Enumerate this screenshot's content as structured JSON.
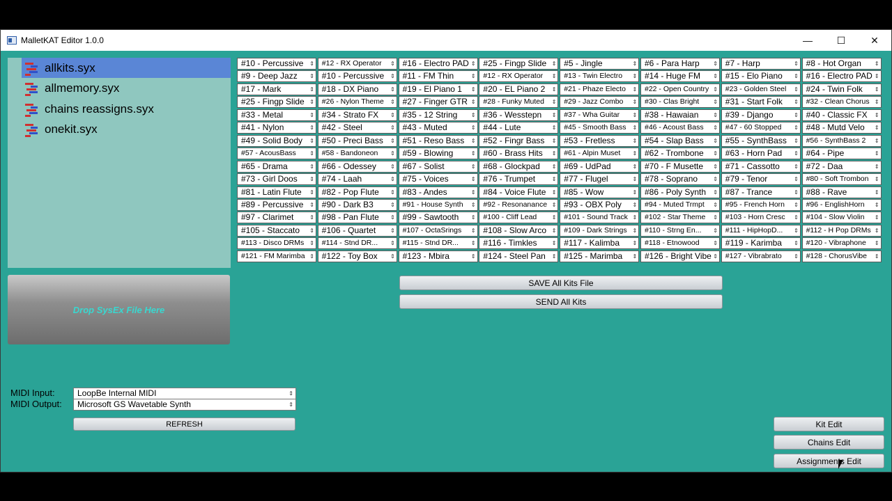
{
  "window": {
    "title": "MalletKAT Editor 1.0.0",
    "minimize_glyph": "—",
    "maximize_glyph": "☐",
    "close_glyph": "✕"
  },
  "files": [
    {
      "name": "allkits.syx",
      "selected": true
    },
    {
      "name": "allmemory.syx",
      "selected": false
    },
    {
      "name": "chains reassigns.syx",
      "selected": false
    },
    {
      "name": "onekit.syx",
      "selected": false
    }
  ],
  "drop_zone": {
    "label": "Drop SysEx File Here"
  },
  "kits": [
    [
      "#10 - Percussive",
      "#12 - RX Operator",
      "#16 - Electro PAD",
      "#25 - Fingp Slide",
      "#5 - Jingle",
      "#6 - Para Harp",
      "#7 - Harp",
      "#8 - Hot Organ"
    ],
    [
      "#9 - Deep Jazz",
      "#10 - Percussive",
      "#11 - FM Thin",
      "#12 - RX Operator",
      "#13 - Twin Electro",
      "#14 - Huge FM",
      "#15 - Elo Piano",
      "#16 - Electro PAD"
    ],
    [
      "#17 - Mark",
      "#18 - DX Piano",
      "#19 - El Piano 1",
      "#20 - EL Piano 2",
      "#21 - Phaze Electo",
      "#22 - Open Country",
      "#23 - Golden Steel",
      "#24 - Twin Folk"
    ],
    [
      "#25 - Fingp Slide",
      "#26 - Nylon Theme",
      "#27 - Finger GTR",
      "#28 - Funky Muted",
      "#29 - Jazz Combo",
      "#30 - Clas Bright",
      "#31 - Start Folk",
      "#32 - Clean Chorus"
    ],
    [
      "#33 - Metal",
      "#34 - Strato FX",
      "#35 - 12 String",
      "#36 - Wesstepn",
      "#37 - Wha Guitar",
      "#38 - Hawaian",
      "#39 - Django",
      "#40 - Classic FX"
    ],
    [
      "#41 - Nylon",
      "#42 - Steel",
      "#43 - Muted",
      "#44 - Lute",
      "#45 - Smooth Bass",
      "#46 - Acoust Bass",
      "#47 - 60 Stopped",
      "#48 - Mutd Velo"
    ],
    [
      "#49 - Solid Body",
      "#50 - Preci Bass",
      "#51 - Reso  Bass",
      "#52 - Fingr Bass",
      "#53 - Fretless",
      "#54 - Slap Bass",
      "#55 - SynthBass",
      "#56 - SynthBass 2"
    ],
    [
      "#57 - AcousBass",
      "#58 - Bandoneon",
      "#59 - Blowing",
      "#60 - Brass Hits",
      "#61 - Alpin Muset",
      "#62 - Trombone",
      "#63 - Horn Pad",
      "#64 - Pipe"
    ],
    [
      "#65 - Drama",
      "#66 - Odessey",
      "#67 - Solist",
      "#68 - Glockpad",
      "#69 - UdPad",
      "#70 - F Musette",
      "#71 - Cassotto",
      "#72 - Daa"
    ],
    [
      "#73 - Girl Doos",
      "#74 - Laah",
      "#75 - Voices",
      "#76 - Trumpet",
      "#77 - Flugel",
      "#78 - Soprano",
      "#79 - Tenor",
      "#80 - Soft Trombon"
    ],
    [
      "#81 - Latin Flute",
      "#82 - Pop   Flute",
      "#83 - Andes",
      "#84 - Voice Flute",
      "#85 - Wow",
      "#86 - Poly Synth",
      "#87 - Trance",
      "#88 - Rave"
    ],
    [
      "#89 - Percussive",
      "#90 - Dark B3",
      "#91 - House Synth",
      "#92 - Resonanance",
      "#93 - OBX Poly",
      "#94 - Muted Trmpt",
      "#95 - French Horn",
      "#96 - EnglishHorn"
    ],
    [
      "#97 - Clarimet",
      "#98 - Pan Flute",
      "#99 - Sawtooth",
      "#100 - Cliff Lead",
      "#101 - Sound Track",
      "#102 - Star Theme",
      "#103 - Horn Cresc",
      "#104 - Slow Violin"
    ],
    [
      "#105 - Staccato",
      "#106 - Quartet",
      "#107 - OctaSrings",
      "#108 - Slow Arco",
      "#109 - Dark Strings",
      "#110 - Strng En...",
      "#111 - HipHopD...",
      "#112 - H Pop DRMs"
    ],
    [
      "#113 - Disco DRMs",
      "#114 - Stnd DR...",
      "#115 - Stnd DR...",
      "#116 - Timkles",
      "#117 - Kalimba",
      "#118 - Etnowood",
      "#119 - Karimba",
      "#120 - Vibraphone"
    ],
    [
      "#121 - FM Marimba",
      "#122 - Toy Box",
      "#123 - Mbira",
      "#124 - Steel Pan",
      "#125 - Marimba",
      "#126 - Bright Vibe",
      "#127 - Vibrabrato",
      "#128 - ChorusVibe"
    ]
  ],
  "small_font_cells": [
    "#12 - RX Operator",
    "#26 - Nylon Theme",
    "#28 - Funky Muted",
    "#29 - Jazz Combo",
    "#21 - Phaze Electo",
    "#22 - Open Country",
    "#23 - Golden Steel",
    "#32 - Clean Chorus",
    "#13 - Twin Electro",
    "#37 - Wha Guitar",
    "#45 - Smooth Bass",
    "#46 - Acoust Bass",
    "#47 - 60 Stopped",
    "#56 - SynthBass 2",
    "#57 - AcousBass",
    "#58 - Bandoneon",
    "#61 - Alpin Muset",
    "#80 - Soft Trombon",
    "#91 - House Synth",
    "#92 - Resonanance",
    "#94 - Muted Trmpt",
    "#95 - French Horn",
    "#96 - EnglishHorn",
    "#101 - Sound Track",
    "#102 - Star Theme",
    "#103 - Horn Cresc",
    "#104 - Slow Violin",
    "#107 - OctaSrings",
    "#109 - Dark Strings",
    "#110 - Strng En...",
    "#111 - HipHopD...",
    "#112 - H Pop DRMs",
    "#113 - Disco DRMs",
    "#114 - Stnd DR...",
    "#115 - Stnd DR...",
    "#120 - Vibraphone",
    "#121 - FM Marimba",
    "#127 - Vibrabrato",
    "#128 - ChorusVibe",
    "#30 - Clas Bright",
    "#100 - Cliff Lead",
    "#118 - Etnowood"
  ],
  "actions": {
    "save_all": "SAVE All Kits File",
    "send_all": "SEND All Kits"
  },
  "midi": {
    "input_label": "MIDI Input:",
    "input_value": "LoopBe Internal MIDI",
    "output_label": "MIDI Output:",
    "output_value": "Microsoft GS Wavetable Synth",
    "refresh": "REFRESH"
  },
  "nav": {
    "kit_edit": "Kit Edit",
    "chains_edit": "Chains Edit",
    "assignments_edit": "Assignments Edit"
  },
  "colors": {
    "background": "#2aa396",
    "selection": "#5a86d6",
    "drop_text": "#39d8d0"
  }
}
